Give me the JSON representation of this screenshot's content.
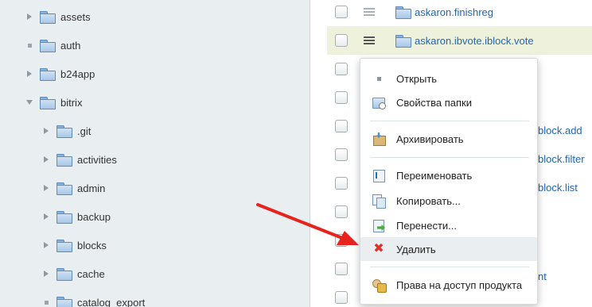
{
  "tree": {
    "items": [
      {
        "label": "assets",
        "toggle": "collapsed"
      },
      {
        "label": "auth",
        "toggle": "leaf"
      },
      {
        "label": "b24app",
        "toggle": "collapsed"
      },
      {
        "label": "bitrix",
        "toggle": "expanded"
      },
      {
        "label": ".git",
        "toggle": "collapsed"
      },
      {
        "label": "activities",
        "toggle": "collapsed"
      },
      {
        "label": "admin",
        "toggle": "collapsed"
      },
      {
        "label": "backup",
        "toggle": "collapsed"
      },
      {
        "label": "blocks",
        "toggle": "collapsed"
      },
      {
        "label": "cache",
        "toggle": "collapsed"
      },
      {
        "label": "catalog_export",
        "toggle": "leaf"
      }
    ]
  },
  "list": {
    "rows": [
      {
        "name": "askaron.finishreg"
      },
      {
        "name": "askaron.ibvote.iblock.vote"
      }
    ],
    "fragments": [
      "block.add",
      "block.filter",
      "block.list",
      "nt"
    ]
  },
  "context_menu": {
    "items": [
      {
        "label": "Открыть",
        "icon": "dot-icon"
      },
      {
        "label": "Свойства папки",
        "icon": "folder-properties-icon"
      },
      {
        "label": "Архивировать",
        "icon": "archive-icon"
      },
      {
        "label": "Переименовать",
        "icon": "rename-icon"
      },
      {
        "label": "Копировать...",
        "icon": "copy-icon"
      },
      {
        "label": "Перенести...",
        "icon": "move-icon"
      },
      {
        "label": "Удалить",
        "icon": "delete-icon"
      },
      {
        "label": "Права на доступ продукта",
        "icon": "access-rights-icon"
      }
    ],
    "delete_color": "#e0322a"
  },
  "annotation": {
    "color": "#e8231e"
  }
}
